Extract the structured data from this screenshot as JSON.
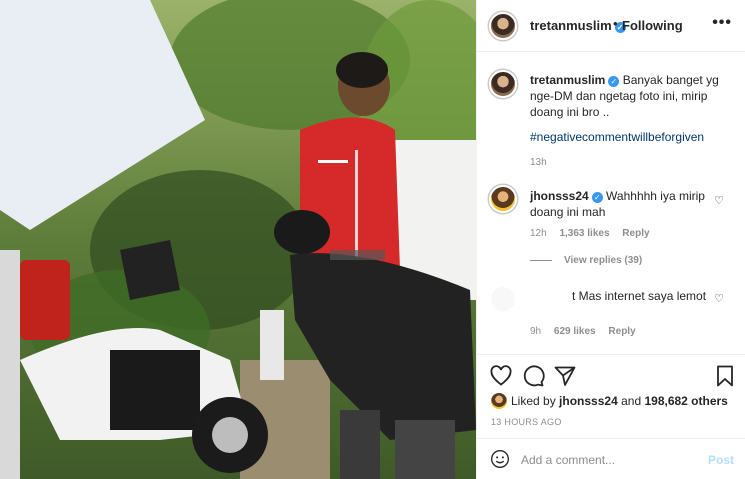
{
  "header": {
    "username": "tretanmuslim",
    "separator": "•",
    "follow_status": "Following",
    "more_icon": "more-icon",
    "more_glyph": "•••"
  },
  "caption": {
    "username": "tretanmuslim",
    "text": "Banyak banget yg nge-DM dan ngetag foto ini, mirip doang ini bro ..",
    "hashtag": "#negativecommentwillbeforgiven",
    "time": "13h"
  },
  "comments": [
    {
      "username": "jhonsss24",
      "verified": true,
      "text": "Wahhhhh iya mirip doang ini mah",
      "time": "12h",
      "likes": "1,363 likes",
      "reply": "Reply",
      "view_replies": "View replies (39)"
    },
    {
      "username": "",
      "text": "t Mas internet saya lemot",
      "time": "9h",
      "likes": "629 likes",
      "reply": "Reply"
    }
  ],
  "actions": {
    "like_icon": "heart-icon",
    "comment_icon": "comment-icon",
    "share_icon": "share-icon",
    "save_icon": "bookmark-icon"
  },
  "likes_line": {
    "prefix": "Liked by",
    "user": "jhonsss24",
    "and": "and",
    "others": "198,682 others"
  },
  "posted": "13 HOURS AGO",
  "add_comment": {
    "placeholder": "Add a comment...",
    "post_label": "Post"
  },
  "colors": {
    "link": "#00376b",
    "verified": "#3897f0",
    "post_disabled": "#b2dffc",
    "muted": "#8e8e8e"
  }
}
